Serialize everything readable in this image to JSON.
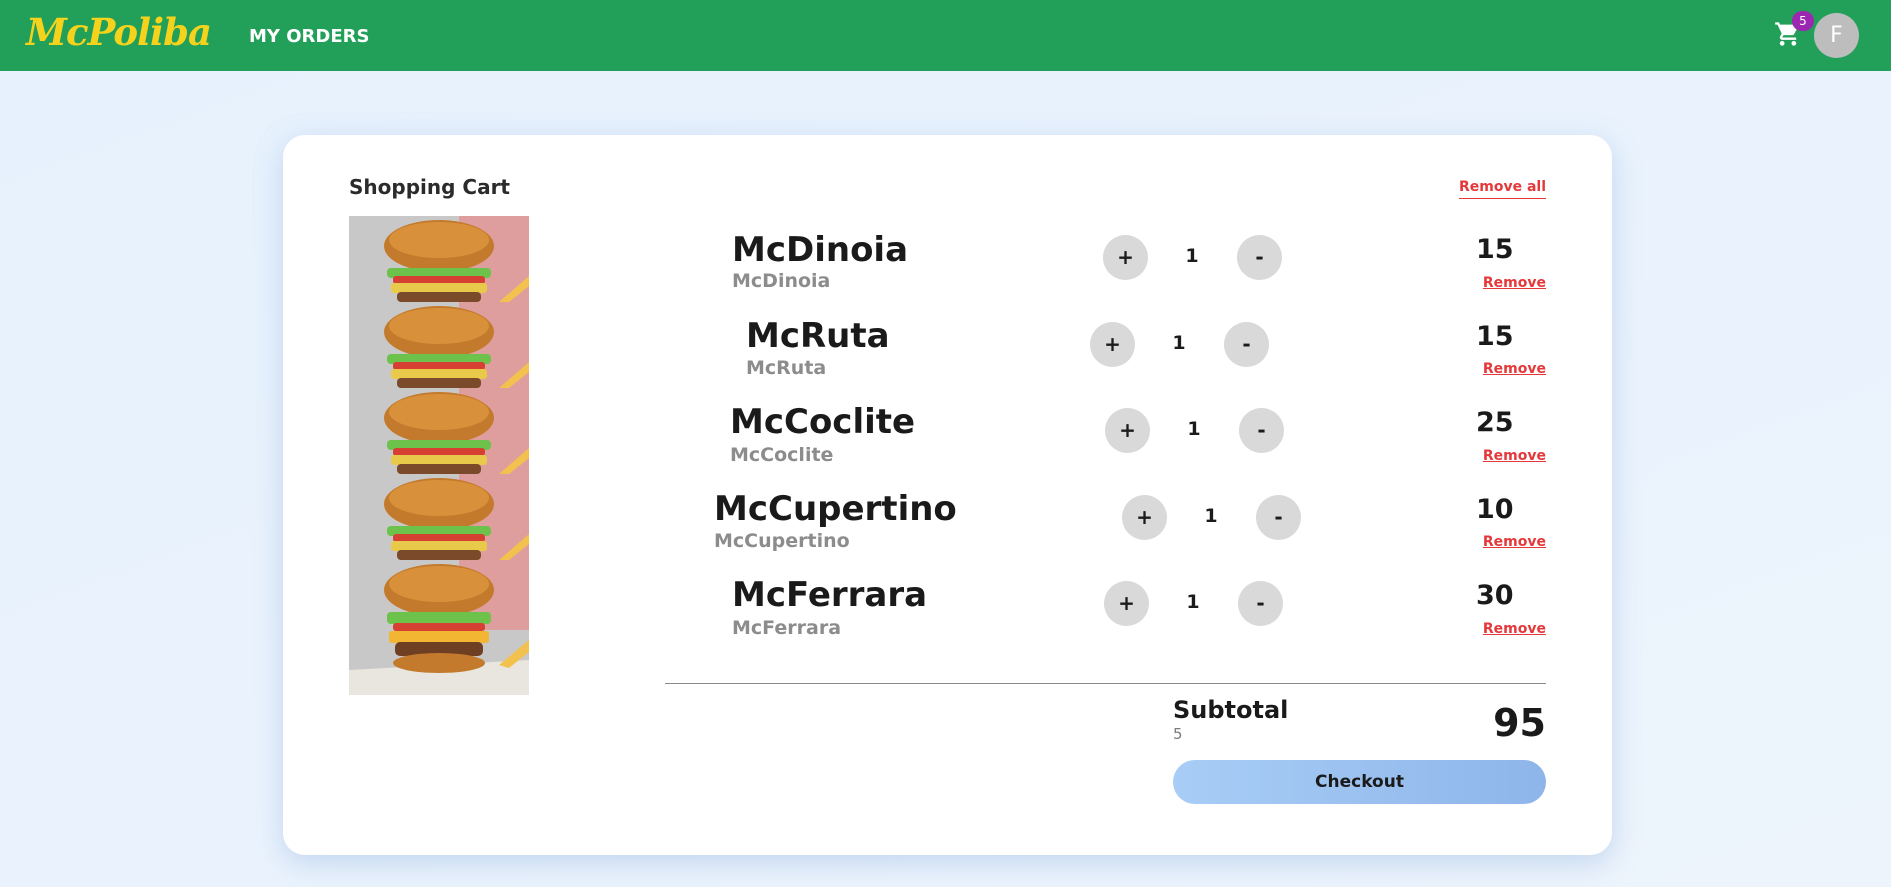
{
  "header": {
    "logo": "McPoliba",
    "nav_orders": "MY ORDERS",
    "cart_count": "5",
    "avatar_initial": "F",
    "bg_color": "#22a05a",
    "logo_color": "#f5d31c"
  },
  "cart": {
    "title": "Shopping Cart",
    "remove_all": "Remove all",
    "items": [
      {
        "name": "McDinoia",
        "sub": "McDinoia",
        "plus": "+",
        "qty": "1",
        "minus": "-",
        "price": "15",
        "remove": "Remove"
      },
      {
        "name": "McRuta",
        "sub": "McRuta",
        "plus": "+",
        "qty": "1",
        "minus": "-",
        "price": "15",
        "remove": "Remove"
      },
      {
        "name": "McCoclite",
        "sub": "McCoclite",
        "plus": "+",
        "qty": "1",
        "minus": "-",
        "price": "25",
        "remove": "Remove"
      },
      {
        "name": "McCupertino",
        "sub": "McCupertino",
        "plus": "+",
        "qty": "1",
        "minus": "-",
        "price": "10",
        "remove": "Remove"
      },
      {
        "name": "McFerrara",
        "sub": "McFerrara",
        "plus": "+",
        "qty": "1",
        "minus": "-",
        "price": "30",
        "remove": "Remove"
      }
    ],
    "subtotal_label": "Subtotal",
    "subtotal_count": "5",
    "subtotal_value": "95",
    "checkout": "Checkout",
    "accent_remove": "#e5383b",
    "checkout_color": "#a8cdf6"
  }
}
